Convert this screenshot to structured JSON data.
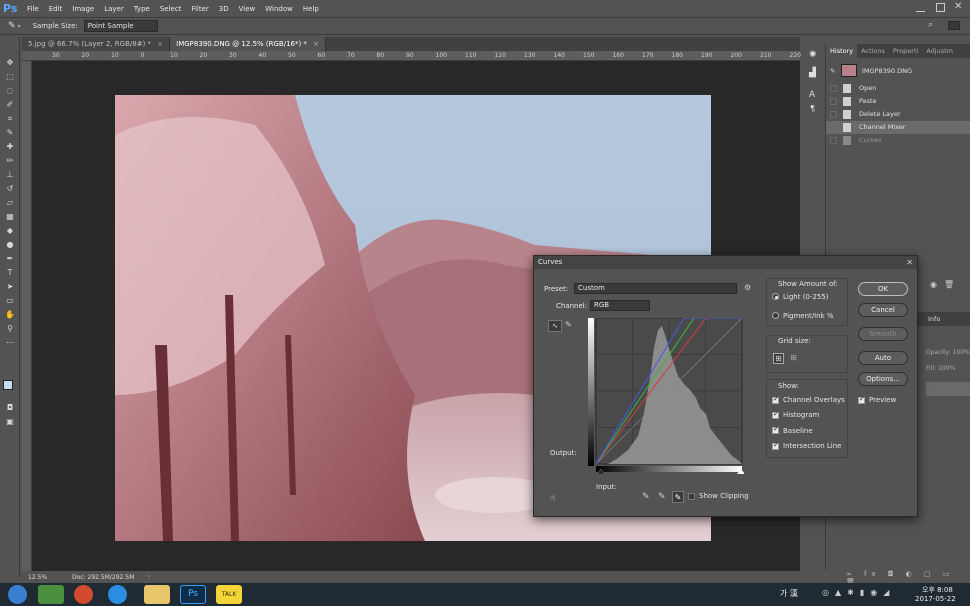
{
  "app": {
    "logo": "Ps",
    "menu": [
      "File",
      "Edit",
      "Image",
      "Layer",
      "Type",
      "Select",
      "Filter",
      "3D",
      "View",
      "Window",
      "Help"
    ]
  },
  "options_bar": {
    "sample_size_label": "Sample Size:",
    "sample_size_value": "Point Sample"
  },
  "document_tabs": [
    {
      "label": "5.jpg @ 66.7% (Layer 2, RGB/8#) *",
      "active": false
    },
    {
      "label": "IMGP8390.DNG @ 12.5% (RGB/16*) *",
      "active": true
    }
  ],
  "ruler_marks": [
    "30",
    "20",
    "10",
    "0",
    "10",
    "20",
    "30",
    "40",
    "50",
    "60",
    "70",
    "80",
    "90",
    "100",
    "110",
    "120",
    "130",
    "140",
    "150",
    "160",
    "170",
    "180",
    "190",
    "200",
    "210",
    "220"
  ],
  "status_bar": {
    "zoom": "12.5%",
    "doc": "Doc: 292.5M/292.5M"
  },
  "panel_tabs": [
    "History",
    "Actions",
    "Properti",
    "Adjustm"
  ],
  "history": {
    "snapshot": "IMGP8390.DNG",
    "items": [
      {
        "label": "Open",
        "state": "normal"
      },
      {
        "label": "Paste",
        "state": "normal"
      },
      {
        "label": "Delete Layer",
        "state": "normal"
      },
      {
        "label": "Channel Mixer",
        "state": "selected"
      },
      {
        "label": "Curves",
        "state": "dim"
      }
    ]
  },
  "layers_panel": {
    "tab": "Info",
    "opacity_label": "Opacity: 100%",
    "fill_label": "Fill: 100%"
  },
  "curves": {
    "title": "Curves",
    "preset_label": "Preset:",
    "preset_value": "Custom",
    "channel_label": "Channel:",
    "channel_value": "RGB",
    "output_label": "Output:",
    "input_label": "Input:",
    "show_clipping": "Show Clipping",
    "show_amount_title": "Show Amount of:",
    "light_label": "Light  (0-255)",
    "pigment_label": "Pigment/Ink %",
    "grid_size_title": "Grid size:",
    "show_title": "Show:",
    "checkboxes": [
      {
        "label": "Channel Overlays",
        "checked": true
      },
      {
        "label": "Histogram",
        "checked": true
      },
      {
        "label": "Baseline",
        "checked": true
      },
      {
        "label": "Intersection Line",
        "checked": true
      }
    ],
    "buttons": {
      "ok": "OK",
      "cancel": "Cancel",
      "smooth": "Smooth",
      "auto": "Auto",
      "options": "Options..."
    },
    "preview_label": "Preview",
    "colors": {
      "red": "#d63a3a",
      "green": "#3cb43c",
      "blue": "#3f5fe0",
      "composite": "#e8e8e8"
    }
  },
  "taskbar": {
    "ime": "가 漢",
    "time": "오후 8:08",
    "date": "2017-05-22"
  }
}
